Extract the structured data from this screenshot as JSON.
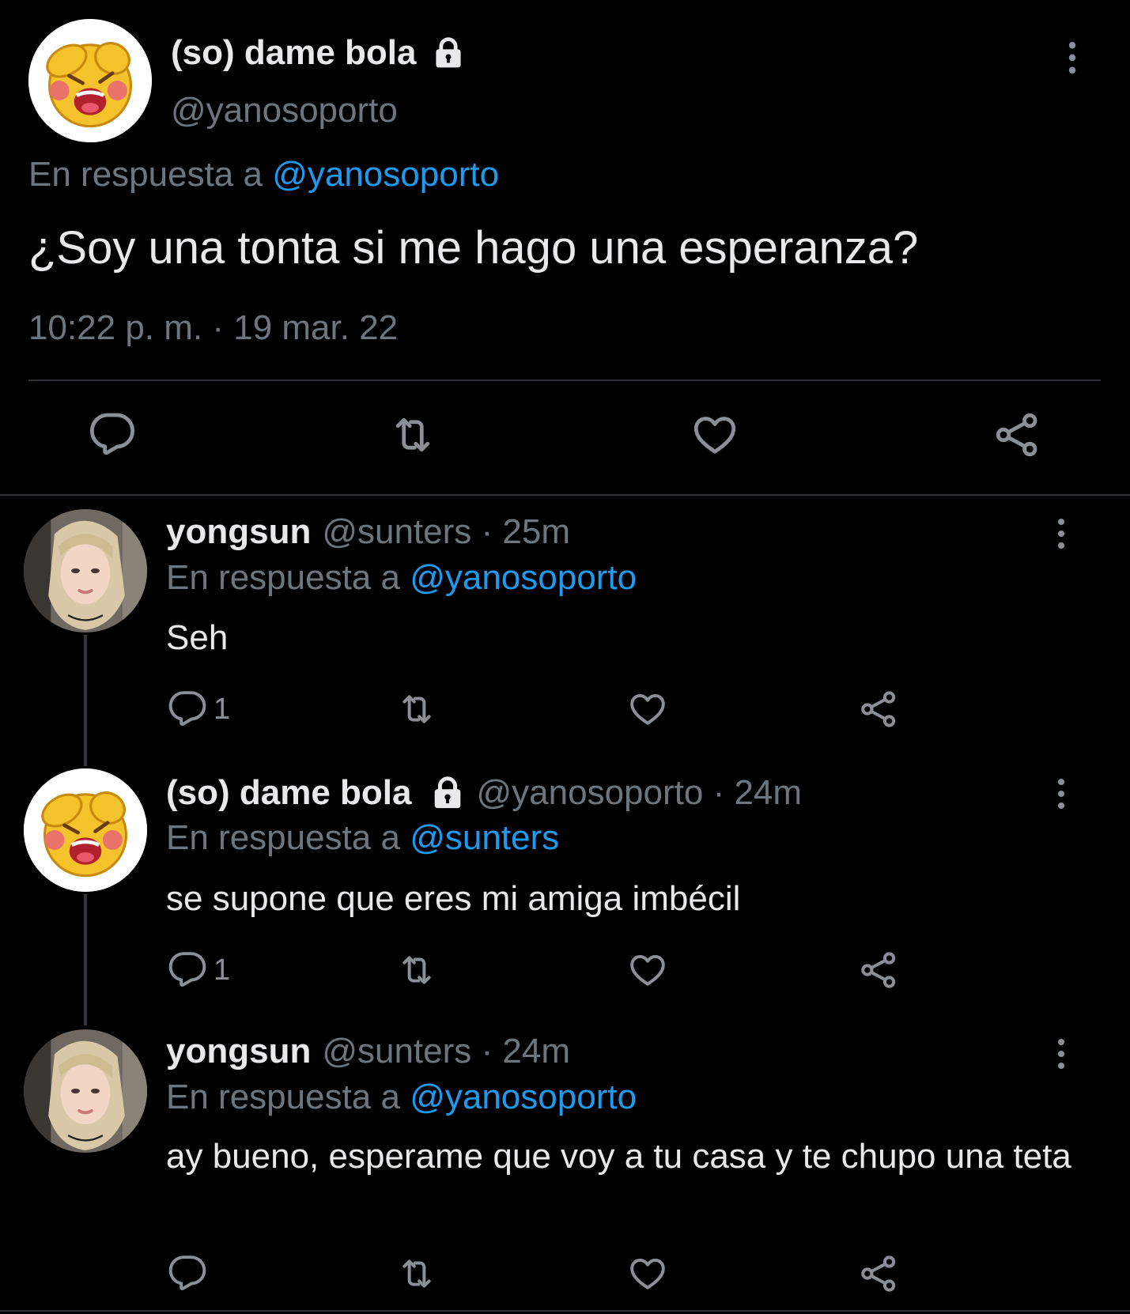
{
  "main_tweet": {
    "display_name": "(so) dame bola",
    "handle": "@yanosoporto",
    "replying_prefix": "En respuesta a",
    "replying_to": "@yanosoporto",
    "text": "¿Soy una tonta si me hago una esperanza?",
    "timestamp": "10:22 p. m. · 19 mar. 22"
  },
  "replies": [
    {
      "display_name": "yongsun",
      "meta": "@sunters · 25m",
      "replying_prefix": "En respuesta a",
      "replying_to": "@yanosoporto",
      "text": "Seh",
      "reply_count": "1"
    },
    {
      "display_name": "(so) dame bola",
      "meta": "@yanosoporto · 24m",
      "replying_prefix": "En respuesta a",
      "replying_to": "@sunters",
      "text": "se supone que eres mi amiga imbécil",
      "reply_count": "1"
    },
    {
      "display_name": "yongsun",
      "meta": "@sunters · 24m",
      "replying_prefix": "En respuesta a",
      "replying_to": "@yanosoporto",
      "text": "ay bueno, esperame que voy a tu casa y te chupo una teta",
      "reply_count": ""
    }
  ],
  "icons": {
    "reply": "reply-icon",
    "retweet": "retweet-icon",
    "like": "like-icon",
    "share": "share-icon",
    "more": "more-icon",
    "lock": "lock-icon"
  },
  "colors": {
    "background": "#000000",
    "text": "#e7e9ea",
    "secondary": "#6e767d",
    "accent": "#1d9bf0"
  }
}
